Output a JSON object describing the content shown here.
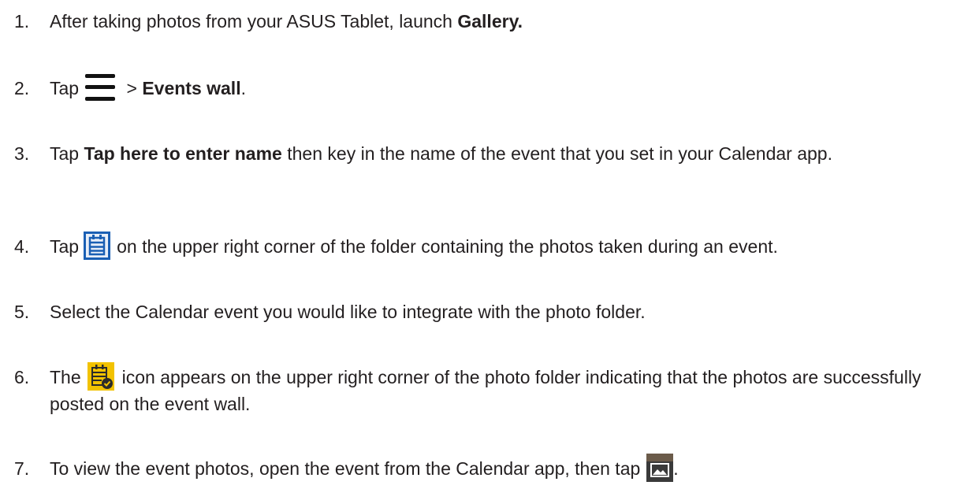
{
  "steps": [
    {
      "num": "1.",
      "pre": "After taking photos from your ASUS Tablet, launch ",
      "bold": "Gallery.",
      "post": ""
    },
    {
      "num": "2.",
      "pre": "Tap",
      "icon": "menu-icon",
      "mid": " > ",
      "bold": "Events wall",
      "post": "."
    },
    {
      "num": "3.",
      "pre": "Tap ",
      "bold": "Tap here to enter name",
      "post": " then key in the name of the event that you set in your Calendar app."
    },
    {
      "num": "4.",
      "pre": "Tap",
      "icon": "calendar-icon",
      "post": "on the upper right corner of the folder containing the photos taken during an event."
    },
    {
      "num": "5.",
      "text": "Select the Calendar event you would like to integrate with the photo folder."
    },
    {
      "num": "6.",
      "pre": "The",
      "icon": "event-check-icon",
      "post": "icon appears on the upper right corner of the photo folder indicating that the photos are successfully posted on the event wall."
    },
    {
      "num": "7.",
      "pre": "To view the event photos, open the event from the Calendar app, then tap",
      "icon": "photo-icon",
      "post": "."
    }
  ],
  "colors": {
    "text": "#231f20",
    "calendar_icon_blue": "#1a5fb4",
    "event_icon_yellow": "#f2c200",
    "photo_icon_bg": "#3a3a3a"
  }
}
